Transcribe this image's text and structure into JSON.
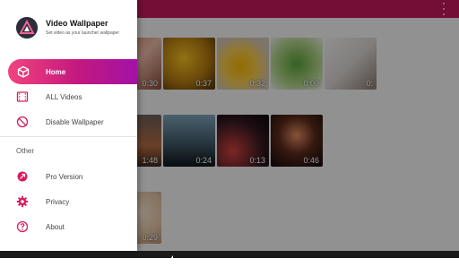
{
  "drawer": {
    "app_title": "Video Wallpaper",
    "app_subtitle": "Set video as your launcher wallpaper",
    "items": [
      {
        "label": "Home",
        "icon": "home-icon",
        "active": true
      },
      {
        "label": "ALL Videos",
        "icon": "film-icon"
      },
      {
        "label": "Disable Wallpaper",
        "icon": "block-icon"
      }
    ],
    "section_title": "Other",
    "other_items": [
      {
        "label": "Pro Version",
        "icon": "pro-icon"
      },
      {
        "label": "Privacy",
        "icon": "gear-icon"
      },
      {
        "label": "About",
        "icon": "help-icon"
      }
    ]
  },
  "background": {
    "appbar_color": "#c2185b",
    "thumbnails": [
      {
        "duration": "0:30"
      },
      {
        "duration": "0:37"
      },
      {
        "duration": "0:32"
      },
      {
        "duration": "0:09"
      },
      {
        "duration": "0:"
      },
      {
        "duration": "1:48"
      },
      {
        "duration": "0:24"
      },
      {
        "duration": "0:13"
      },
      {
        "duration": "0:46"
      },
      {
        "duration": "0:29"
      }
    ]
  },
  "colors": {
    "accent_start": "#f2437e",
    "accent_end": "#a312a6",
    "icon_color": "#d81b60"
  }
}
